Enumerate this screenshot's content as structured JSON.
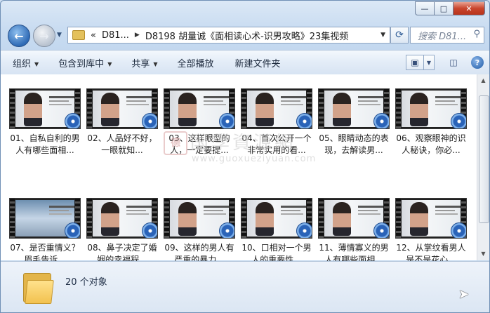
{
  "window": {
    "controls": {
      "minimize": "—",
      "maximize": "□",
      "close": "✕"
    }
  },
  "nav": {
    "back_icon": "back-arrow-icon",
    "forward_icon": "forward-arrow-icon"
  },
  "address": {
    "lead": "«",
    "crumb1": "D81...",
    "sep": "▶",
    "crumb2": "D8198 胡量诚《面相读心术-识男攻略》23集视频",
    "dropdown": "▼"
  },
  "search": {
    "placeholder": "搜索 D81..."
  },
  "toolbar": {
    "organize": "组织",
    "include_library": "包含到库中",
    "share": "共享",
    "play_all": "全部播放",
    "new_folder": "新建文件夹"
  },
  "files": [
    {
      "label": "01、自私自利的男人有哪些面相...",
      "thumb": "face"
    },
    {
      "label": "02、人品好不好，一眼就知...",
      "thumb": "face"
    },
    {
      "label": "03、这样眼型的人，一定要提...",
      "thumb": "face"
    },
    {
      "label": "04、首次公开一个非常实用的看...",
      "thumb": "face"
    },
    {
      "label": "05、眼睛动态的表现，去解读男...",
      "thumb": "face"
    },
    {
      "label": "06、观察眼神的识人秘诀，你必...",
      "thumb": "face"
    },
    {
      "label": "07、是否重情义？眉毛告诉...",
      "thumb": "scene"
    },
    {
      "label": "08、鼻子决定了婚姻的幸福程...",
      "thumb": "face"
    },
    {
      "label": "09、这样的男人有严重的暴力...",
      "thumb": "face"
    },
    {
      "label": "10、口相对一个男人的重要性...",
      "thumb": "face"
    },
    {
      "label": "11、薄情寡义的男人有哪些面相...",
      "thumb": "face"
    },
    {
      "label": "12、从掌纹看男人是不是花心...",
      "thumb": "face"
    }
  ],
  "watermark": {
    "seal": "德",
    "cn": "国學資源網",
    "url": "www.guoxueziyuan.com"
  },
  "status": {
    "count": "20 个对象"
  }
}
